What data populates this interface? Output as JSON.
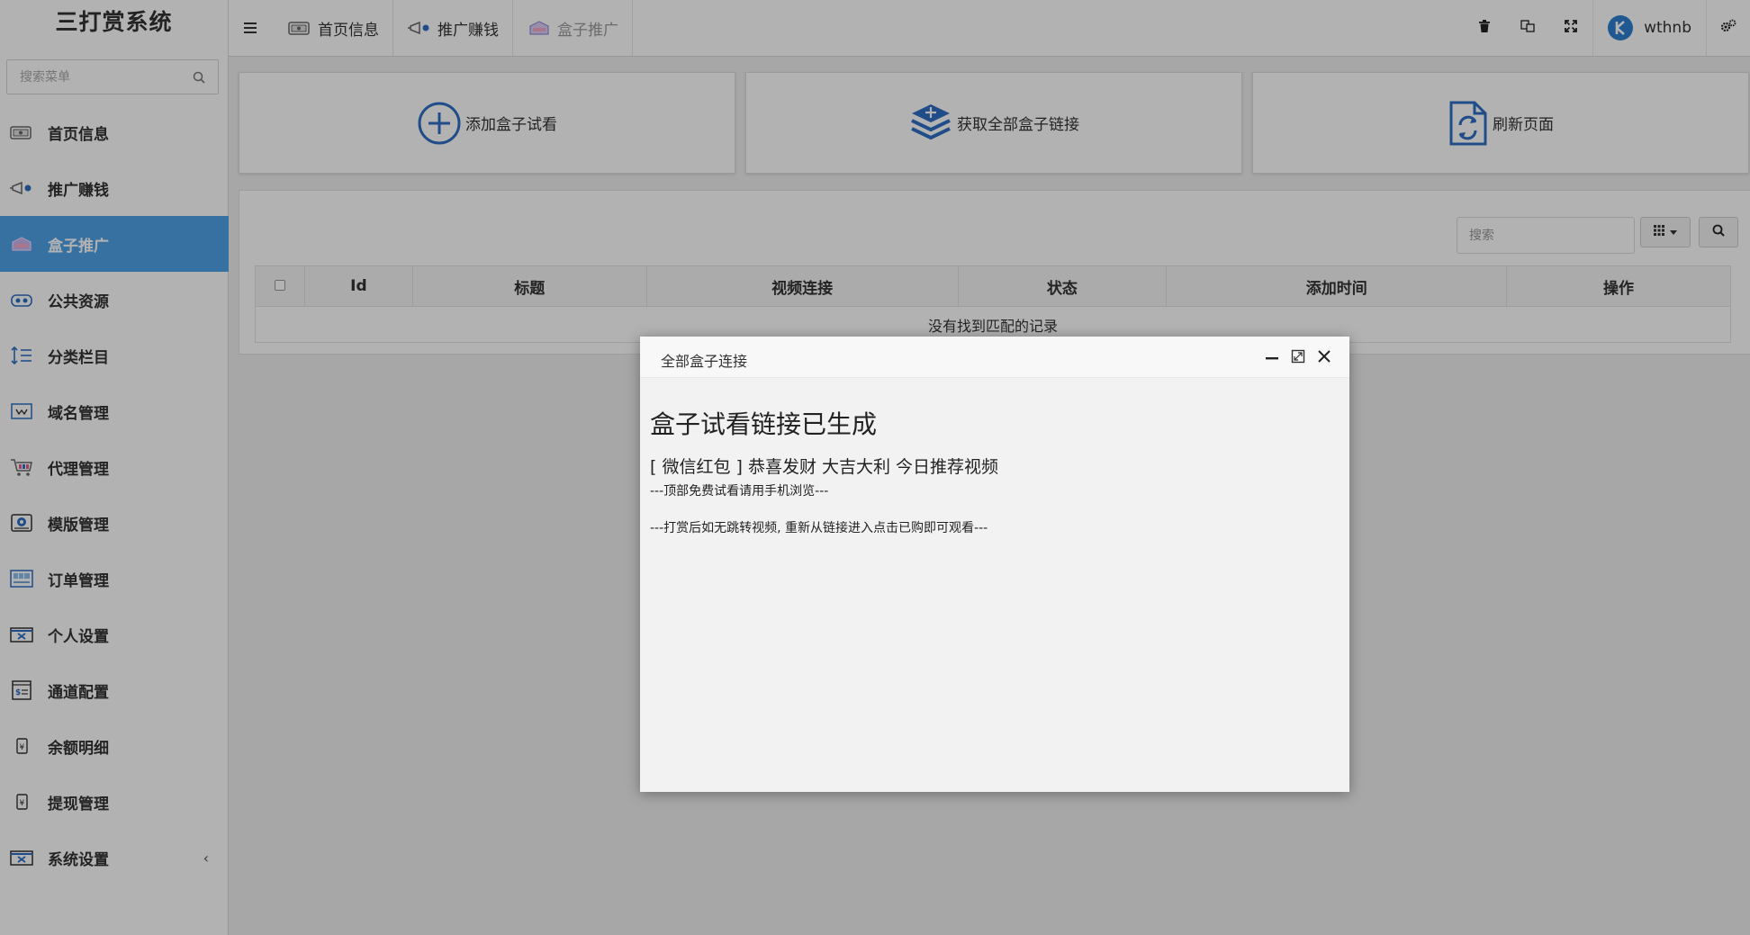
{
  "brand": "三打赏系统",
  "sidebar": {
    "search_placeholder": "搜索菜单",
    "items": [
      {
        "label": "首页信息",
        "icon": "home-card-icon",
        "active": false
      },
      {
        "label": "推广赚钱",
        "icon": "megaphone-icon",
        "active": false
      },
      {
        "label": "盒子推广",
        "icon": "box-icon",
        "active": true
      },
      {
        "label": "公共资源",
        "icon": "people-icon",
        "active": false
      },
      {
        "label": "分类栏目",
        "icon": "sort-list-icon",
        "active": false
      },
      {
        "label": "域名管理",
        "icon": "domain-icon",
        "active": false
      },
      {
        "label": "代理管理",
        "icon": "cart-icon",
        "active": false
      },
      {
        "label": "模版管理",
        "icon": "template-icon",
        "active": false
      },
      {
        "label": "订单管理",
        "icon": "order-icon",
        "active": false
      },
      {
        "label": "个人设置",
        "icon": "profile-settings-icon",
        "active": false
      },
      {
        "label": "通道配置",
        "icon": "channel-icon",
        "active": false
      },
      {
        "label": "余额明细",
        "icon": "balance-icon",
        "active": false
      },
      {
        "label": "提现管理",
        "icon": "withdraw-icon",
        "active": false
      },
      {
        "label": "系统设置",
        "icon": "system-settings-icon",
        "active": false,
        "has_submenu": true
      }
    ]
  },
  "header": {
    "tabs": [
      {
        "label": "首页信息",
        "icon": "home-card-icon"
      },
      {
        "label": "推广赚钱",
        "icon": "megaphone-icon"
      },
      {
        "label": "盒子推广",
        "icon": "box-icon",
        "current": true
      }
    ],
    "username": "wthnb"
  },
  "actions": [
    {
      "label": "添加盒子试看",
      "icon": "plus-circle-icon"
    },
    {
      "label": "获取全部盒子链接",
      "icon": "layers-icon"
    },
    {
      "label": "刷新页面",
      "icon": "refresh-file-icon"
    }
  ],
  "table": {
    "search_placeholder": "搜索",
    "columns": [
      "Id",
      "标题",
      "视频连接",
      "状态",
      "添加时间",
      "操作"
    ],
    "empty_text": "没有找到匹配的记录"
  },
  "modal": {
    "title": "全部盒子连接",
    "heading": "盒子试看链接已生成",
    "line1": "[ 微信红包 ] 恭喜发财 大吉大利 今日推荐视频",
    "line2": "---顶部免费试看请用手机浏览---",
    "line3": "---打赏后如无跳转视频, 重新从链接进入点击已购即可观看---"
  },
  "colors": {
    "accent": "#4fa3e8",
    "icon_blue": "#2f6fc4",
    "overlay": "rgba(0,0,0,0.30)"
  }
}
